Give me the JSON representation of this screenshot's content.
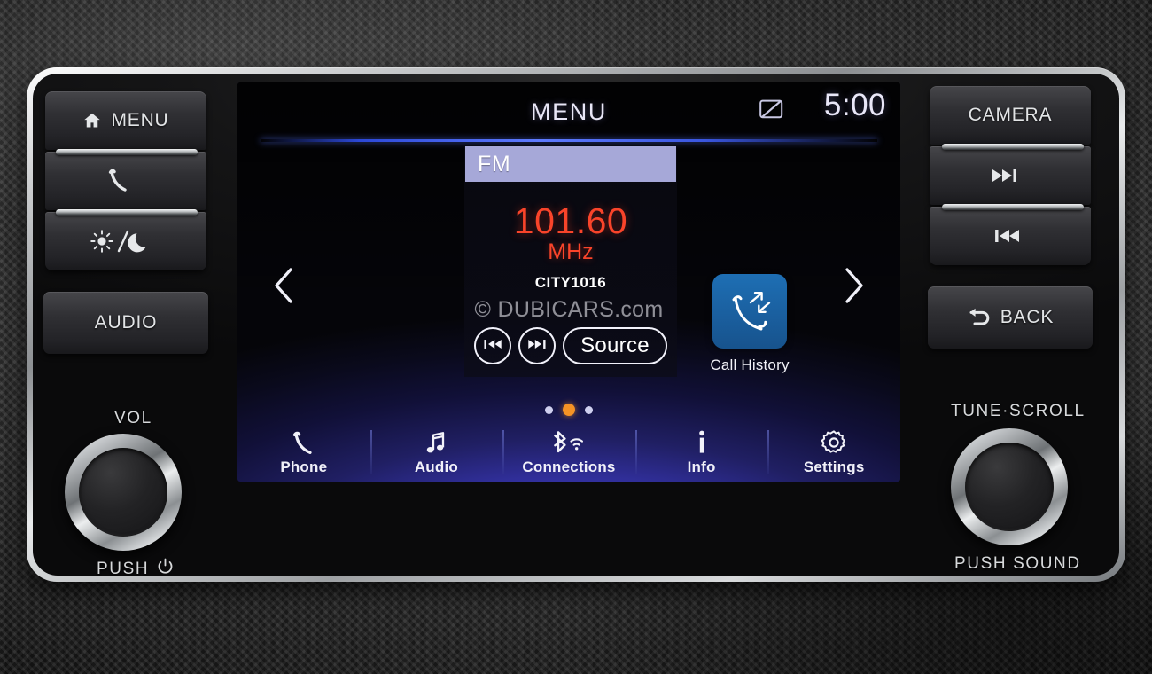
{
  "hard_keys": {
    "left": [
      {
        "name": "menu",
        "label": "MENU",
        "icon": "home-icon"
      },
      {
        "name": "phone",
        "label": "",
        "icon": "phone-handset-icon"
      },
      {
        "name": "brightness",
        "label": "",
        "icon": "sun-moon-icon"
      },
      {
        "name": "audio",
        "label": "AUDIO",
        "icon": ""
      }
    ],
    "right": [
      {
        "name": "camera",
        "label": "CAMERA",
        "icon": ""
      },
      {
        "name": "next-track",
        "label": "",
        "icon": "next-track-icon"
      },
      {
        "name": "prev-track",
        "label": "",
        "icon": "prev-track-icon"
      },
      {
        "name": "back",
        "label": "BACK",
        "icon": "back-arrow-icon"
      }
    ]
  },
  "knobs": {
    "left": {
      "top_label": "VOL",
      "bottom_label": "PUSH",
      "bottom_icon": "power-icon"
    },
    "right": {
      "top_label": "TUNE·SCROLL",
      "bottom_label": "PUSH  SOUND"
    }
  },
  "screen": {
    "header": {
      "title": "MENU",
      "clock": "5:00",
      "status_icon": "mute-display-off-icon"
    },
    "nav_arrows": {
      "left": "chevron-left-icon",
      "right": "chevron-right-icon"
    },
    "fm_widget": {
      "band": "FM",
      "frequency": "101.60",
      "unit": "MHz",
      "station": "CITY1016",
      "controls": [
        {
          "name": "prev-track-button",
          "icon": "prev-track-icon",
          "label": ""
        },
        {
          "name": "next-track-button",
          "icon": "next-track-icon",
          "label": ""
        },
        {
          "name": "source-button",
          "icon": "",
          "label": "Source"
        }
      ]
    },
    "tile": {
      "label": "Call History",
      "icon": "call-history-icon"
    },
    "pager": {
      "count": 3,
      "active_index": 1,
      "active_color": "#f59325",
      "inactive_color": "#cfd0ef"
    },
    "nav_bar": [
      {
        "name": "phone",
        "label": "Phone",
        "icon": "phone-handset-icon"
      },
      {
        "name": "audio",
        "label": "Audio",
        "icon": "music-note-icon"
      },
      {
        "name": "connections",
        "label": "Connections",
        "icon": "bluetooth-wifi-icon"
      },
      {
        "name": "info",
        "label": "Info",
        "icon": "info-icon"
      },
      {
        "name": "settings",
        "label": "Settings",
        "icon": "gear-icon"
      }
    ]
  },
  "watermark": "© DUBICARS.com",
  "colors": {
    "fm_frequency": "#f9442a",
    "band_bar": "#a6a8d8",
    "tile_blue": "#1a5f9f",
    "accent_orange": "#f59325",
    "header_rule": "#5e7bff"
  }
}
